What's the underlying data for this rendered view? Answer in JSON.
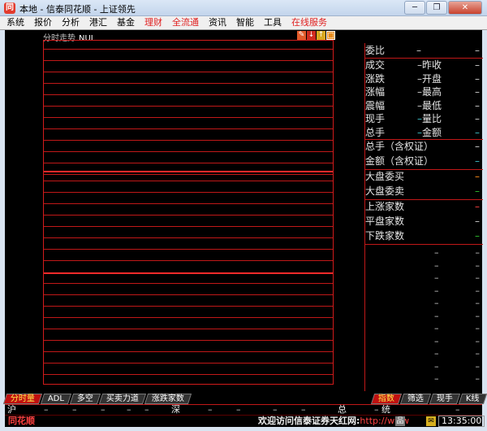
{
  "window": {
    "title": "本地 - 信泰同花顺 - 上证领先",
    "icon_glyph": "同",
    "minimize_glyph": "─",
    "restore_glyph": "❐",
    "close_glyph": "✕"
  },
  "menu": [
    {
      "label": "系统",
      "color": "#000000"
    },
    {
      "label": "报价",
      "color": "#000000"
    },
    {
      "label": "分析",
      "color": "#000000"
    },
    {
      "label": "港汇",
      "color": "#000000"
    },
    {
      "label": "基金",
      "color": "#000000"
    },
    {
      "label": "理财",
      "color": "#e02020"
    },
    {
      "label": "全流通",
      "color": "#e02020"
    },
    {
      "label": "资讯",
      "color": "#000000"
    },
    {
      "label": "智能",
      "color": "#000000"
    },
    {
      "label": "工具",
      "color": "#000000"
    },
    {
      "label": "在线服务",
      "color": "#e02020"
    }
  ],
  "chart": {
    "title": "分时走势",
    "code": "NUL",
    "tool_glyphs": [
      "✎",
      "↓",
      "↑",
      "□"
    ]
  },
  "quote": {
    "weibi_label": "委比",
    "weibi_value": "–",
    "weibi_end": "–",
    "rows": [
      {
        "k1": "成交",
        "d1": "–",
        "k2": "昨收",
        "d2": "–"
      },
      {
        "k1": "涨跌",
        "d1": "–",
        "k2": "开盘",
        "d2": "–"
      },
      {
        "k1": "涨幅",
        "d1": "–",
        "k2": "最高",
        "d2": "–"
      },
      {
        "k1": "震幅",
        "d1": "–",
        "k2": "最低",
        "d2": "–"
      },
      {
        "k1": "现手",
        "d1": "–",
        "k2": "量比",
        "d2": "–"
      },
      {
        "k1": "总手",
        "d1": "–",
        "k2": "金额",
        "d2": "–"
      }
    ],
    "warrant_total_label": "总手（含权证）",
    "warrant_total_value": "–",
    "warrant_amount_label": "金额（含权证）",
    "warrant_amount_value": "–",
    "big_buy_label": "大盘委买",
    "big_buy_value": "–",
    "big_sell_label": "大盘委卖",
    "big_sell_value": "–",
    "up_count_label": "上涨家数",
    "up_count_value": "–",
    "flat_count_label": "平盘家数",
    "flat_count_value": "–",
    "down_count_label": "下跌家数",
    "down_count_value": "–",
    "ticks": [
      "–",
      "–",
      "–",
      "–",
      "–",
      "–",
      "–",
      "–",
      "–",
      "–",
      "–"
    ]
  },
  "tabs_left": [
    {
      "label": "分时量",
      "active": true
    },
    {
      "label": "ADL",
      "active": false
    },
    {
      "label": "多空",
      "active": false
    },
    {
      "label": "买卖力道",
      "active": false
    },
    {
      "label": "涨跌家数",
      "active": false
    }
  ],
  "tabs_right": [
    {
      "label": "指数",
      "active": true
    },
    {
      "label": "筛选",
      "active": false
    },
    {
      "label": "现手",
      "active": false
    },
    {
      "label": "K线",
      "active": false
    }
  ],
  "ticker": {
    "sh_label": "沪",
    "sh_values": [
      "–",
      "–",
      "–",
      "–",
      "–"
    ],
    "sz_label": "深",
    "sz_values": [
      "–",
      "–",
      "–",
      "–"
    ],
    "total_label": "总",
    "stat_label": "统",
    "stat_prefix": "–",
    "stat_value": "–"
  },
  "status": {
    "brand": "同花顺",
    "marquee_text": "欢迎访问信泰证券天红网:",
    "marquee_url": "http://www",
    "net_glyph": "品",
    "msg_glyph": "✉",
    "time": "13:35:00"
  },
  "colors": {
    "grid": "#c01818",
    "grid_strong": "#ff2a2a",
    "background": "#000000",
    "accent_red": "#ff4040"
  }
}
